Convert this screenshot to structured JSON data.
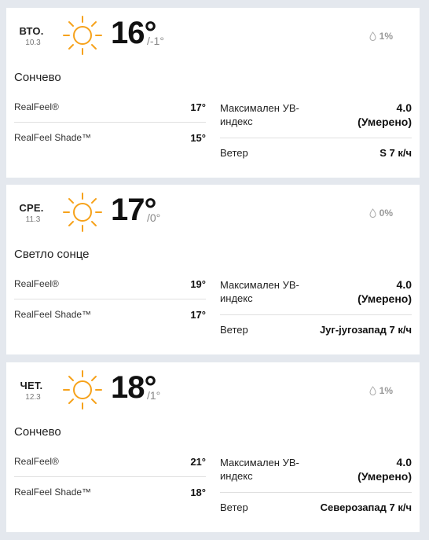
{
  "colors": {
    "sun": "#f6a21b",
    "background": "#e4e8ee",
    "card": "#ffffff"
  },
  "days": [
    {
      "day": "ВТО.",
      "date": "10.3",
      "icon": "sun-icon",
      "temp_hi": "16°",
      "temp_lo": "/-1°",
      "precip": "1%",
      "phrase": "Сончево",
      "realfeel_label": "RealFeel®",
      "realfeel_value": "17°",
      "realfeel_shade_label": "RealFeel Shade™",
      "realfeel_shade_value": "15°",
      "uv_label": "Максимален УВ-индекс",
      "uv_value": "4.0",
      "uv_desc": "(Умерено)",
      "wind_label": "Ветер",
      "wind_value": "S 7 к/ч"
    },
    {
      "day": "СРЕ.",
      "date": "11.3",
      "icon": "sun-icon",
      "temp_hi": "17°",
      "temp_lo": "/0°",
      "precip": "0%",
      "phrase": "Светло сонце",
      "realfeel_label": "RealFeel®",
      "realfeel_value": "19°",
      "realfeel_shade_label": "RealFeel Shade™",
      "realfeel_shade_value": "17°",
      "uv_label": "Максимален УВ-индекс",
      "uv_value": "4.0",
      "uv_desc": "(Умерено)",
      "wind_label": "Ветер",
      "wind_value": "Југ-југозапад 7 к/ч"
    },
    {
      "day": "ЧЕТ.",
      "date": "12.3",
      "icon": "sun-icon",
      "temp_hi": "18°",
      "temp_lo": "/1°",
      "precip": "1%",
      "phrase": "Сончево",
      "realfeel_label": "RealFeel®",
      "realfeel_value": "21°",
      "realfeel_shade_label": "RealFeel Shade™",
      "realfeel_shade_value": "18°",
      "uv_label": "Максимален УВ-индекс",
      "uv_value": "4.0",
      "uv_desc": "(Умерено)",
      "wind_label": "Ветер",
      "wind_value": "Северозапад 7 к/ч"
    }
  ]
}
